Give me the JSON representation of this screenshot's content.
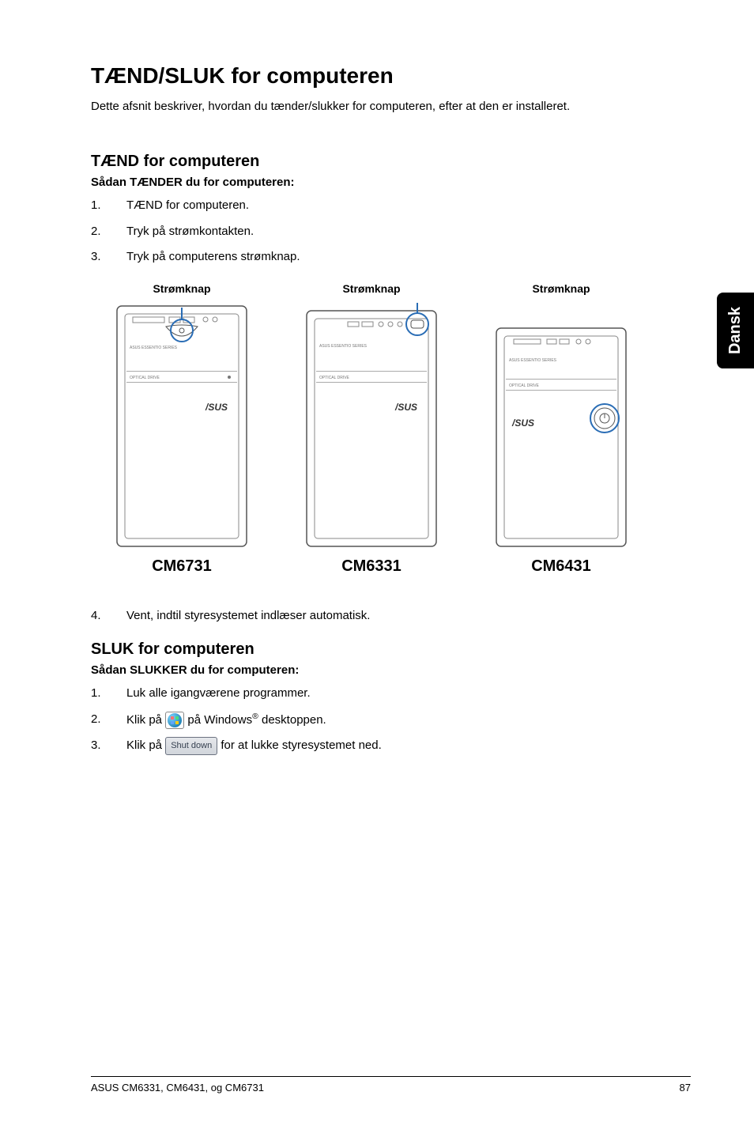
{
  "sideTab": "Dansk",
  "title": "TÆND/SLUK for computeren",
  "intro": "Dette afsnit beskriver, hvordan du tænder/slukker for computeren, efter at den er installeret.",
  "on": {
    "heading": "TÆND for computeren",
    "sub": "Sådan TÆNDER du for computeren:",
    "steps": [
      "TÆND for computeren.",
      "Tryk på strømkontakten.",
      "Tryk på computerens strømknap."
    ],
    "after": "Vent, indtil styresystemet indlæser automatisk."
  },
  "towers": {
    "buttonLabel": "Strømknap",
    "items": [
      {
        "model": "CM6731"
      },
      {
        "model": "CM6331"
      },
      {
        "model": "CM6431"
      }
    ]
  },
  "off": {
    "heading": "SLUK for computeren",
    "sub": "Sådan SLUKKER du for computeren:",
    "step1": "Luk alle igangværene programmer.",
    "step2_a": "Klik på ",
    "step2_b": " på Windows",
    "step2_c": " desktoppen.",
    "step3_a": "Klik på ",
    "step3_btn": "Shut down",
    "step3_b": " for at lukke styresystemet ned."
  },
  "footer": {
    "left": "ASUS CM6331, CM6431, og CM6731",
    "right": "87"
  }
}
